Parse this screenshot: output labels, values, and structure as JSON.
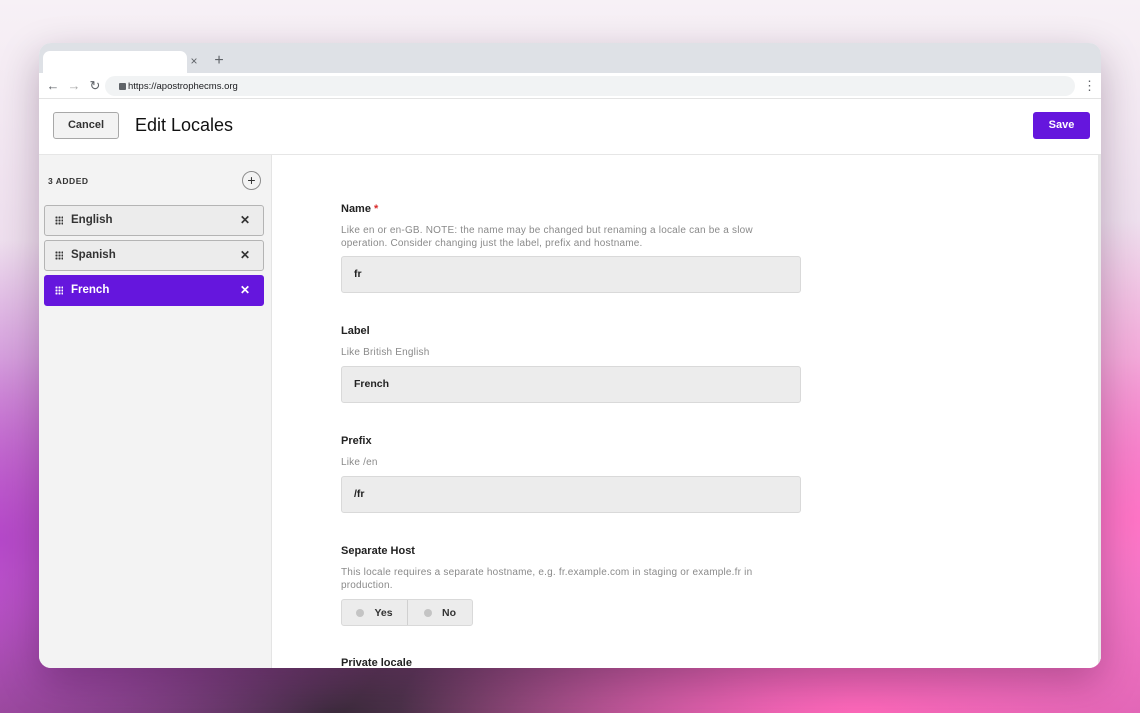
{
  "browser": {
    "url": "https://apostrophecms.org",
    "tab_close": "×",
    "new_tab": "+",
    "back": "←",
    "forward": "→",
    "reload": "↻",
    "menu": "⋮"
  },
  "header": {
    "cancel_label": "Cancel",
    "title": "Edit Locales",
    "save_label": "Save"
  },
  "sidebar": {
    "count_label": "3 ADDED",
    "add_label": "+",
    "locales": [
      {
        "label": "English",
        "active": false
      },
      {
        "label": "Spanish",
        "active": false
      },
      {
        "label": "French",
        "active": true
      }
    ],
    "remove_glyph": "✕"
  },
  "form": {
    "name": {
      "label": "Name",
      "required": "*",
      "help": "Like en or en-GB. NOTE: the name may be changed but renaming a locale can be a slow operation. Consider changing just the label, prefix and hostname.",
      "value": "fr"
    },
    "label": {
      "label": "Label",
      "help": "Like British English",
      "value": "French"
    },
    "prefix": {
      "label": "Prefix",
      "help": "Like /en",
      "value": "/fr"
    },
    "separate_host": {
      "label": "Separate Host",
      "help": "This locale requires a separate hostname, e.g. fr.example.com in staging or example.fr in production.",
      "options": [
        "Yes",
        "No"
      ]
    },
    "private_locale": {
      "label": "Private locale"
    }
  },
  "colors": {
    "accent": "#6516dd",
    "required": "#d92a2a"
  }
}
